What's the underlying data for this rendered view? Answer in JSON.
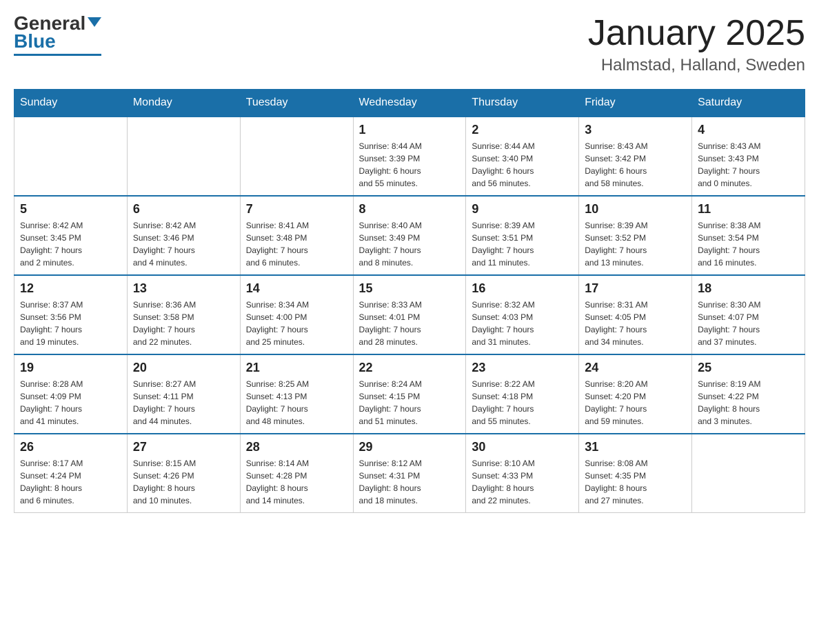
{
  "header": {
    "logo_general": "General",
    "logo_blue": "Blue",
    "month_title": "January 2025",
    "location": "Halmstad, Halland, Sweden"
  },
  "days_of_week": [
    "Sunday",
    "Monday",
    "Tuesday",
    "Wednesday",
    "Thursday",
    "Friday",
    "Saturday"
  ],
  "weeks": [
    [
      {
        "day": "",
        "info": ""
      },
      {
        "day": "",
        "info": ""
      },
      {
        "day": "",
        "info": ""
      },
      {
        "day": "1",
        "info": "Sunrise: 8:44 AM\nSunset: 3:39 PM\nDaylight: 6 hours\nand 55 minutes."
      },
      {
        "day": "2",
        "info": "Sunrise: 8:44 AM\nSunset: 3:40 PM\nDaylight: 6 hours\nand 56 minutes."
      },
      {
        "day": "3",
        "info": "Sunrise: 8:43 AM\nSunset: 3:42 PM\nDaylight: 6 hours\nand 58 minutes."
      },
      {
        "day": "4",
        "info": "Sunrise: 8:43 AM\nSunset: 3:43 PM\nDaylight: 7 hours\nand 0 minutes."
      }
    ],
    [
      {
        "day": "5",
        "info": "Sunrise: 8:42 AM\nSunset: 3:45 PM\nDaylight: 7 hours\nand 2 minutes."
      },
      {
        "day": "6",
        "info": "Sunrise: 8:42 AM\nSunset: 3:46 PM\nDaylight: 7 hours\nand 4 minutes."
      },
      {
        "day": "7",
        "info": "Sunrise: 8:41 AM\nSunset: 3:48 PM\nDaylight: 7 hours\nand 6 minutes."
      },
      {
        "day": "8",
        "info": "Sunrise: 8:40 AM\nSunset: 3:49 PM\nDaylight: 7 hours\nand 8 minutes."
      },
      {
        "day": "9",
        "info": "Sunrise: 8:39 AM\nSunset: 3:51 PM\nDaylight: 7 hours\nand 11 minutes."
      },
      {
        "day": "10",
        "info": "Sunrise: 8:39 AM\nSunset: 3:52 PM\nDaylight: 7 hours\nand 13 minutes."
      },
      {
        "day": "11",
        "info": "Sunrise: 8:38 AM\nSunset: 3:54 PM\nDaylight: 7 hours\nand 16 minutes."
      }
    ],
    [
      {
        "day": "12",
        "info": "Sunrise: 8:37 AM\nSunset: 3:56 PM\nDaylight: 7 hours\nand 19 minutes."
      },
      {
        "day": "13",
        "info": "Sunrise: 8:36 AM\nSunset: 3:58 PM\nDaylight: 7 hours\nand 22 minutes."
      },
      {
        "day": "14",
        "info": "Sunrise: 8:34 AM\nSunset: 4:00 PM\nDaylight: 7 hours\nand 25 minutes."
      },
      {
        "day": "15",
        "info": "Sunrise: 8:33 AM\nSunset: 4:01 PM\nDaylight: 7 hours\nand 28 minutes."
      },
      {
        "day": "16",
        "info": "Sunrise: 8:32 AM\nSunset: 4:03 PM\nDaylight: 7 hours\nand 31 minutes."
      },
      {
        "day": "17",
        "info": "Sunrise: 8:31 AM\nSunset: 4:05 PM\nDaylight: 7 hours\nand 34 minutes."
      },
      {
        "day": "18",
        "info": "Sunrise: 8:30 AM\nSunset: 4:07 PM\nDaylight: 7 hours\nand 37 minutes."
      }
    ],
    [
      {
        "day": "19",
        "info": "Sunrise: 8:28 AM\nSunset: 4:09 PM\nDaylight: 7 hours\nand 41 minutes."
      },
      {
        "day": "20",
        "info": "Sunrise: 8:27 AM\nSunset: 4:11 PM\nDaylight: 7 hours\nand 44 minutes."
      },
      {
        "day": "21",
        "info": "Sunrise: 8:25 AM\nSunset: 4:13 PM\nDaylight: 7 hours\nand 48 minutes."
      },
      {
        "day": "22",
        "info": "Sunrise: 8:24 AM\nSunset: 4:15 PM\nDaylight: 7 hours\nand 51 minutes."
      },
      {
        "day": "23",
        "info": "Sunrise: 8:22 AM\nSunset: 4:18 PM\nDaylight: 7 hours\nand 55 minutes."
      },
      {
        "day": "24",
        "info": "Sunrise: 8:20 AM\nSunset: 4:20 PM\nDaylight: 7 hours\nand 59 minutes."
      },
      {
        "day": "25",
        "info": "Sunrise: 8:19 AM\nSunset: 4:22 PM\nDaylight: 8 hours\nand 3 minutes."
      }
    ],
    [
      {
        "day": "26",
        "info": "Sunrise: 8:17 AM\nSunset: 4:24 PM\nDaylight: 8 hours\nand 6 minutes."
      },
      {
        "day": "27",
        "info": "Sunrise: 8:15 AM\nSunset: 4:26 PM\nDaylight: 8 hours\nand 10 minutes."
      },
      {
        "day": "28",
        "info": "Sunrise: 8:14 AM\nSunset: 4:28 PM\nDaylight: 8 hours\nand 14 minutes."
      },
      {
        "day": "29",
        "info": "Sunrise: 8:12 AM\nSunset: 4:31 PM\nDaylight: 8 hours\nand 18 minutes."
      },
      {
        "day": "30",
        "info": "Sunrise: 8:10 AM\nSunset: 4:33 PM\nDaylight: 8 hours\nand 22 minutes."
      },
      {
        "day": "31",
        "info": "Sunrise: 8:08 AM\nSunset: 4:35 PM\nDaylight: 8 hours\nand 27 minutes."
      },
      {
        "day": "",
        "info": ""
      }
    ]
  ]
}
